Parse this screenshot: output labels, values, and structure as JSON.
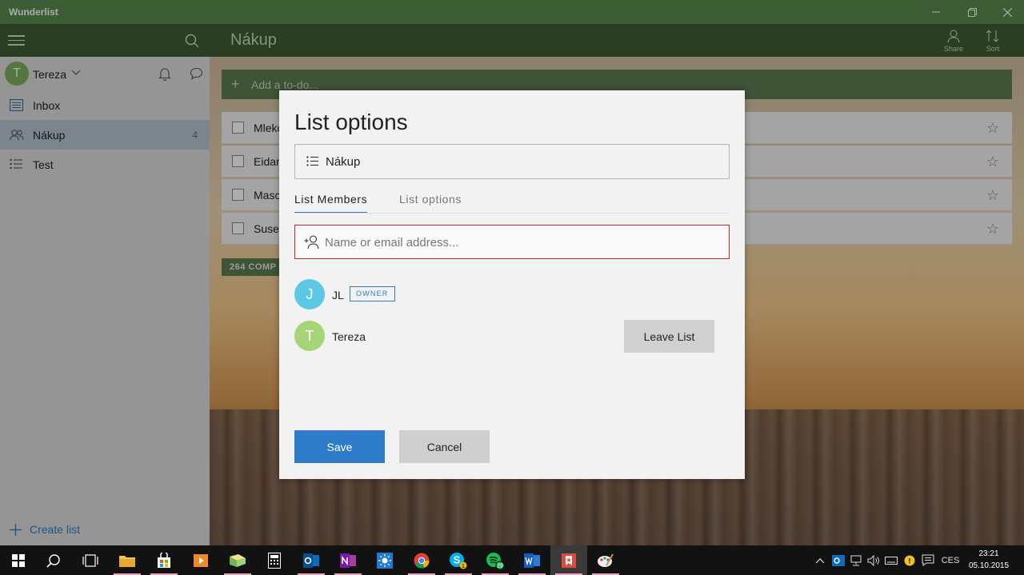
{
  "window": {
    "title": "Wunderlist"
  },
  "sidebar": {
    "user": {
      "initial": "T",
      "name": "Tereza"
    },
    "items": [
      {
        "label": "Inbox",
        "count": ""
      },
      {
        "label": "Nákup",
        "count": "4"
      },
      {
        "label": "Test",
        "count": ""
      }
    ],
    "create_list_label": "Create list"
  },
  "main": {
    "list_title": "Nákup",
    "share_label": "Share",
    "sort_label": "Sort",
    "add_todo_placeholder": "Add a to-do...",
    "tasks": [
      {
        "title": "Mleko"
      },
      {
        "title": "Eidam"
      },
      {
        "title": "Masc"
      },
      {
        "title": "Susen"
      }
    ],
    "completed_label": "264 COMP"
  },
  "dialog": {
    "title": "List options",
    "list_name": "Nákup",
    "tabs": [
      {
        "label": "List Members",
        "active": true
      },
      {
        "label": "List options",
        "active": false
      }
    ],
    "member_input_placeholder": "Name or email address...",
    "members": [
      {
        "initial": "J",
        "name": "JL",
        "badge": "OWNER",
        "avatar_color": "#5bc8e6"
      },
      {
        "initial": "T",
        "name": "Tereza",
        "action_label": "Leave List",
        "avatar_color": "#a6d578"
      }
    ],
    "save_label": "Save",
    "cancel_label": "Cancel"
  },
  "taskbar": {
    "apps": [
      "start-icon",
      "search-icon",
      "task-view-icon",
      "file-explorer-icon",
      "store-icon",
      "media-player-icon",
      "folder-app-icon",
      "calculator-icon",
      "outlook-icon",
      "onenote-icon",
      "weather-icon",
      "chrome-icon",
      "skype-icon",
      "spotify-icon",
      "word-icon",
      "wunderlist-icon",
      "paint-icon"
    ],
    "skype_badge": "1",
    "spotify_badge": "29",
    "language": "CES",
    "time": "23:21",
    "date": "05.10.2015"
  },
  "colors": {
    "accent_green": "#5b8a4e",
    "dark_green": "#3f5c35",
    "primary_blue": "#2d7bc9",
    "input_error_red": "#c4262e"
  }
}
